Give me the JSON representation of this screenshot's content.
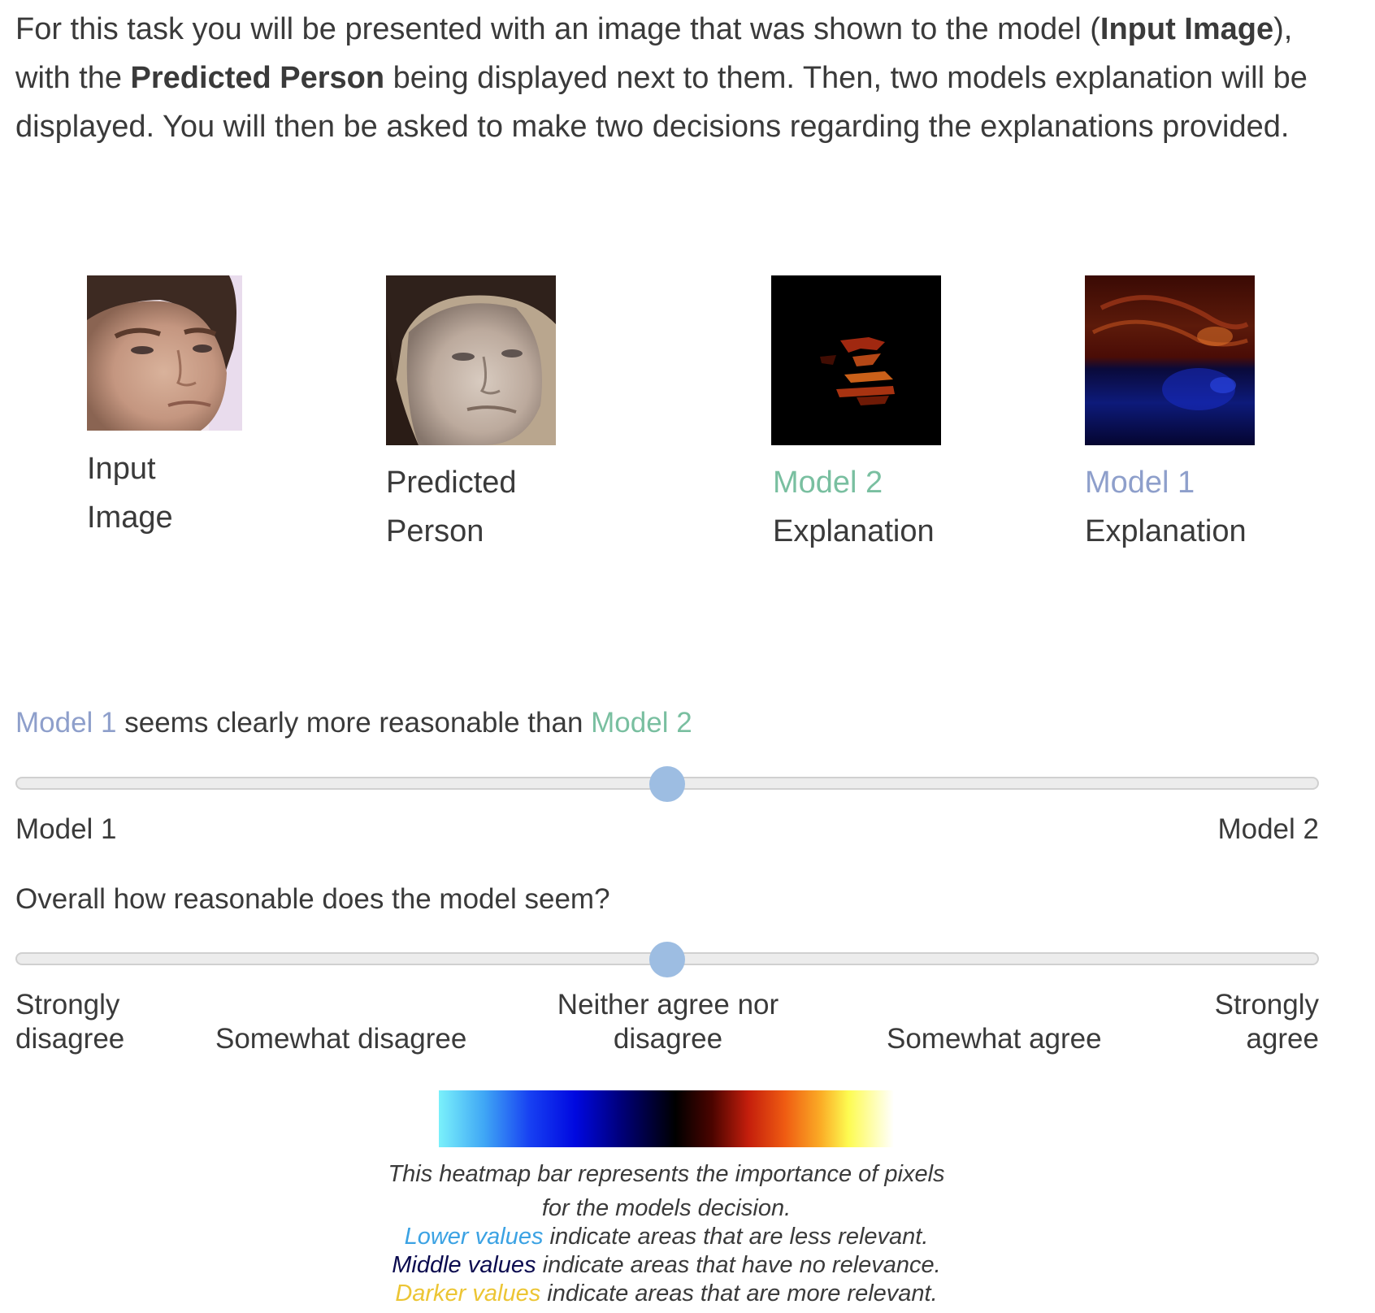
{
  "intro": {
    "t1": "For this task you will be presented with an image that was shown to the model (",
    "b1": "Input Image",
    "t2": "), with the ",
    "b2": "Predicted Person",
    "t3": " being displayed next to them. Then, two models explanation will be displayed. You will then be asked to make two decisions regarding the explanations provided."
  },
  "tiles": {
    "input": {
      "line1": "Input",
      "line2": "Image"
    },
    "predicted": {
      "line1": "Predicted",
      "line2": "Person"
    },
    "model2": {
      "line1": "Model 2",
      "line2": "Explanation"
    },
    "model1": {
      "line1": "Model 1",
      "line2": "Explanation"
    }
  },
  "question1": {
    "model1": "Model 1",
    "middle": " seems clearly more reasonable than ",
    "model2": "Model 2",
    "left_label": "Model 1",
    "right_label": "Model 2",
    "value": 0.5
  },
  "question2": {
    "text": "Overall how reasonable does the model seem?",
    "labels": {
      "strongly_disagree_1": "Strongly",
      "strongly_disagree_2": "disagree",
      "somewhat_disagree": "Somewhat disagree",
      "neither_1": "Neither agree nor",
      "neither_2": "disagree",
      "somewhat_agree": "Somewhat agree",
      "strongly_agree_1": "Strongly",
      "strongly_agree_2": "agree"
    },
    "value": 0.5
  },
  "heatmap": {
    "caption1": "This heatmap bar represents the importance of pixels",
    "caption2": "for the models decision.",
    "lower_key": "Lower values",
    "lower_rest": " indicate areas that are less relevant.",
    "middle_key": "Middle values",
    "middle_rest": " indicate areas that have no relevance.",
    "darker_key": "Darker values",
    "darker_rest": " indicate areas that are more relevant."
  },
  "colors": {
    "model1": "#8e9fcb",
    "model2": "#79bfa0",
    "thumb": "#9dbde2",
    "lower": "#3ba2e3",
    "middle": "#0b0b4f",
    "darker": "#ecc534"
  }
}
